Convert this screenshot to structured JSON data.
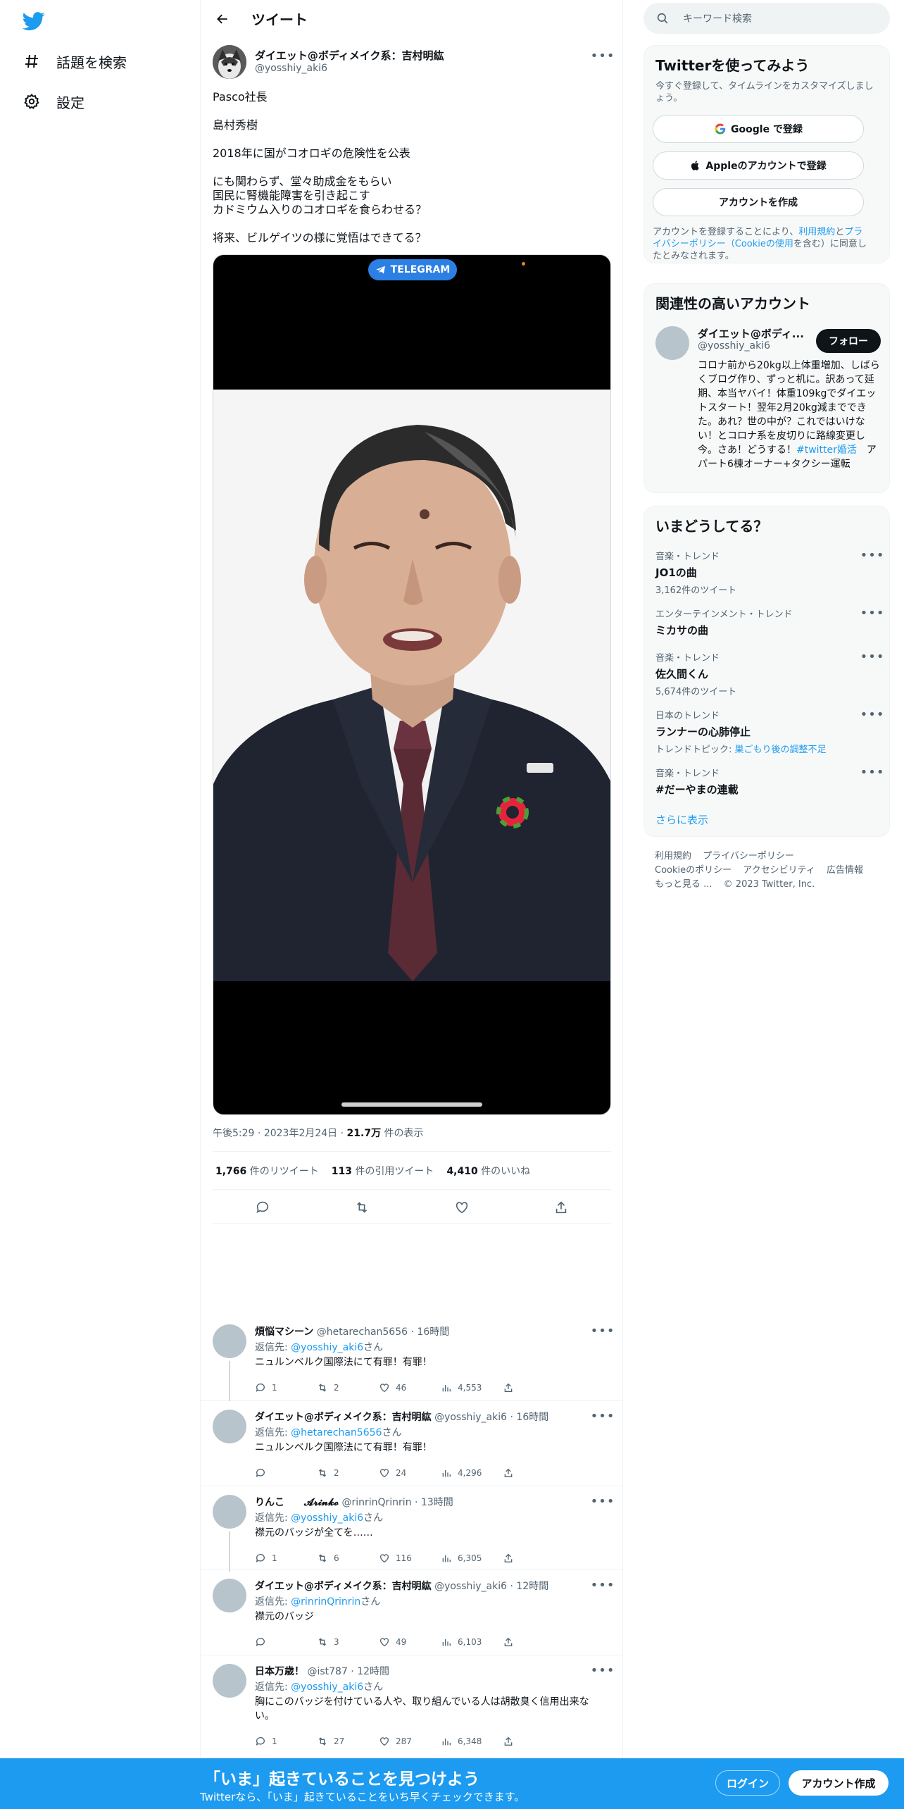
{
  "nav": {
    "items": [
      {
        "label": "話題を検索",
        "icon": "hashtag-icon"
      },
      {
        "label": "設定",
        "icon": "gear-icon"
      }
    ]
  },
  "header": {
    "title": "ツイート"
  },
  "tweet": {
    "author_name": "ダイエット@ボディメイク系：吉村明紘",
    "author_handle": "@yosshiy_aki6",
    "text_lines": [
      "Pasco社長",
      "島村秀樹",
      "2018年に国がコオロギの危険性を公表",
      "にも関わらず、堂々助成金をもらい",
      "国民に腎機能障害を引き起こす",
      "カドミウム入りのコオロギを食らわせる？",
      "将来、ビルゲイツの様に覚悟はできてる？"
    ],
    "media_pill": "TELEGRAM",
    "time": "午後5:29",
    "date": "2023年2月24日",
    "views_count": "21.7万",
    "views_label": "件の表示",
    "retweets": "1,766",
    "retweets_label": "件のリツイート",
    "quotes": "113",
    "quotes_label": "件の引用ツイート",
    "likes": "4,410",
    "likes_label": "件のいいね"
  },
  "replies": [
    {
      "name": "煩悩マシーン",
      "handle": "@hetarechan5656",
      "time": "16時間",
      "reply_prefix": "返信先:",
      "reply_to": "@yosshiy_aki6",
      "reply_suffix": "さん",
      "text": "ニュルンベルク国際法にて有罪！有罪！",
      "replies": "1",
      "retweets": "2",
      "likes": "46",
      "views": "4,553"
    },
    {
      "name": "ダイエット@ボディメイク系：吉村明紘",
      "handle": "@yosshiy_aki6",
      "time": "16時間",
      "reply_prefix": "返信先:",
      "reply_to": "@hetarechan5656",
      "reply_suffix": "さん",
      "text": "ニュルンベルク国際法にて有罪！有罪！",
      "replies": "",
      "retweets": "2",
      "likes": "24",
      "views": "4,296"
    },
    {
      "name": "りんこ　　𝓐𝓻𝓲𝓷𝓴𝓸",
      "handle": "@rinrinQrinrin",
      "time": "13時間",
      "reply_prefix": "返信先:",
      "reply_to": "@yosshiy_aki6",
      "reply_suffix": "さん",
      "text": "襟元のバッジが全てを……",
      "replies": "1",
      "retweets": "6",
      "likes": "116",
      "views": "6,305"
    },
    {
      "name": "ダイエット@ボディメイク系：吉村明紘",
      "handle": "@yosshiy_aki6",
      "time": "12時間",
      "reply_prefix": "返信先:",
      "reply_to": "@rinrinQrinrin",
      "reply_suffix": "さん",
      "text": "襟元のバッジ",
      "replies": "",
      "retweets": "3",
      "likes": "49",
      "views": "6,103"
    },
    {
      "name": "日本万歳！",
      "handle": "@ist787",
      "time": "12時間",
      "reply_prefix": "返信先:",
      "reply_to": "@yosshiy_aki6",
      "reply_suffix": "さん",
      "text": "胸にこのバッジを付けている人や、取り組んでいる人は胡散臭く信用出来ない。",
      "replies": "1",
      "retweets": "27",
      "likes": "287",
      "views": "6,348"
    }
  ],
  "right": {
    "search_placeholder": "キーワード検索",
    "signup_card": {
      "title": "Twitterを使ってみよう",
      "subtitle": "今すぐ登録して、タイムラインをカスタマイズしましょう。",
      "google_label": "Google で登録",
      "apple_label": "Appleのアカウントで登録",
      "create_label": "アカウントを作成",
      "legal_prefix": "アカウントを登録することにより、",
      "terms_link": "利用規約",
      "and": "と",
      "privacy_link": "プライバシーポリシー（Cookieの使用",
      "legal_suffix": "を含む）に同意したとみなされます。"
    },
    "related_card": {
      "title": "関連性の高いアカウント",
      "name": "ダイエット@ボディ...",
      "handle": "@yosshiy_aki6",
      "follow_label": "フォロー",
      "bio": "コロナ前から20kg以上体重増加、しばらくブログ作り、ずっと机に。訳あって延期、本当ヤバイ！体重109kgでダイエットスタート！翌年2月20kg減までできた。あれ？世の中が？これではいけない！とコロナ系を皮切りに路線変更し今。さあ！どうする！",
      "bio_tag": "#twitter婚活",
      "bio_end": "　アパート6棟オーナー+タクシー運転"
    },
    "trends_card": {
      "title": "いまどうしてる？",
      "items": [
        {
          "category": "音楽・トレンド",
          "name": "JO1の曲",
          "count": "3,162件のツイート"
        },
        {
          "category": "エンターテインメント・トレンド",
          "name": "ミカサの曲",
          "count": ""
        },
        {
          "category": "音楽・トレンド",
          "name": "佐久間くん",
          "count": "5,674件のツイート"
        },
        {
          "category": "日本のトレンド",
          "name": "ランナーの心肺停止",
          "count": "トレンドトピック: ",
          "topic": "巣ごもり後の調整不足"
        },
        {
          "category": "音楽・トレンド",
          "name": "#だーやまの連載",
          "count": ""
        }
      ],
      "show_more": "さらに表示"
    },
    "footer": {
      "links_row1": [
        "利用規約",
        "プライバシーポリシー"
      ],
      "links_row2": [
        "Cookieのポリシー",
        "アクセシビリティ",
        "広告情報"
      ],
      "more": "もっと見る ...",
      "copyright": "© 2023 Twitter, Inc."
    }
  },
  "bottom_bar": {
    "title": "「いま」起きていることを見つけよう",
    "subtitle": "Twitterなら、「いま」起きていることをいち早くチェックできます。",
    "login_label": "ログイン",
    "signup_label": "アカウント作成"
  },
  "colors": {
    "brand": "#1d9bf0",
    "text": "#0f1419",
    "muted": "#536471",
    "telegram": "#2c7fe3"
  }
}
